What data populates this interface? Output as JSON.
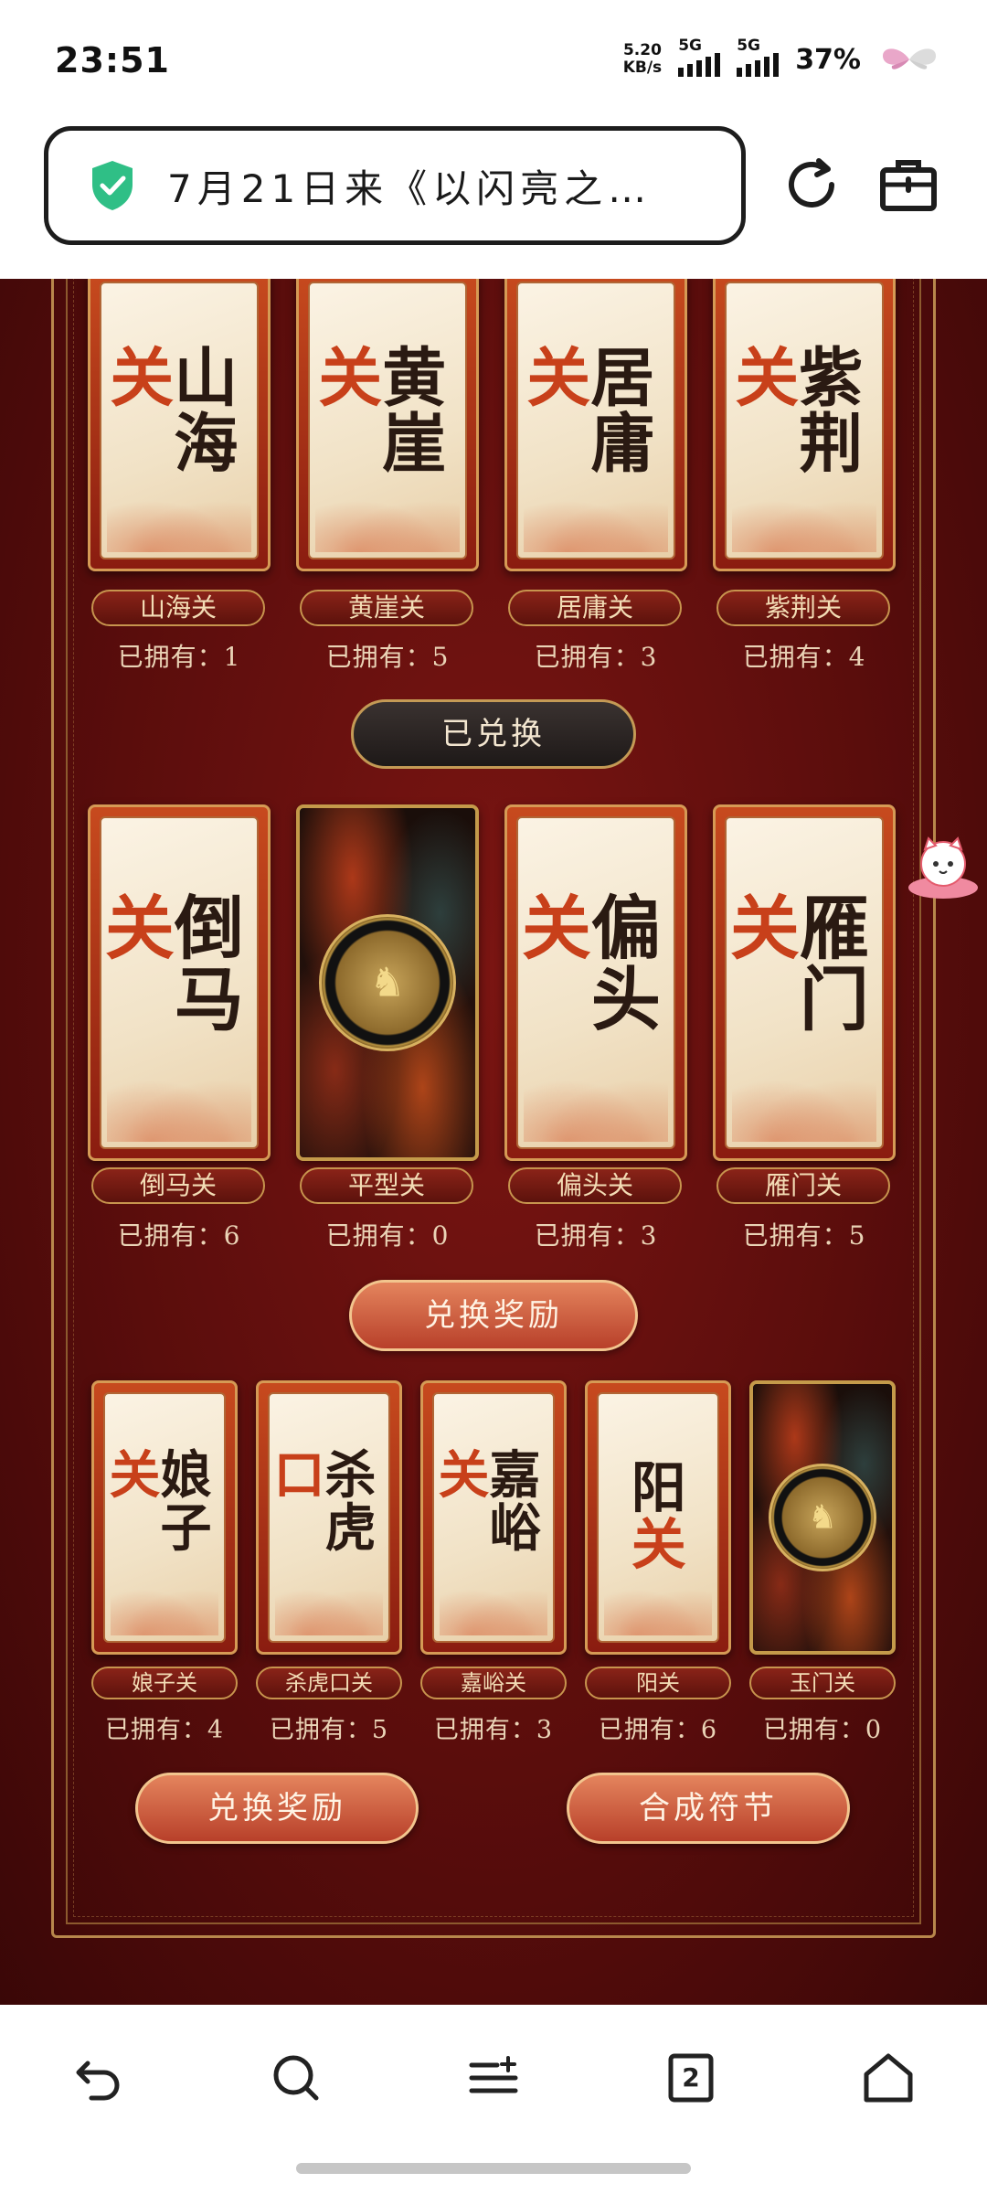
{
  "status_bar": {
    "time": "23:51",
    "net_speed_value": "5.20",
    "net_speed_unit": "KB/s",
    "sim1": "5G",
    "sim2": "5G",
    "battery": "37%"
  },
  "url_bar": {
    "title": "7月21日来《以闪亮之…"
  },
  "colors": {
    "bg_red": "#5a0d0c",
    "gold": "#c7944e",
    "paper": "#f5ead6"
  },
  "buttons": {
    "redeemed": "已兑换",
    "redeem_reward_1": "兑换奖励",
    "redeem_reward_2": "兑换奖励",
    "synthesize": "合成符节"
  },
  "owned_prefix": "已拥有：",
  "row1": [
    {
      "big": "山海关",
      "name": "山海关",
      "owned": "已拥有：1"
    },
    {
      "big": "黄崖关",
      "name": "黄崖关",
      "owned": "已拥有：5"
    },
    {
      "big": "居庸关",
      "name": "居庸关",
      "owned": "已拥有：3"
    },
    {
      "big": "紫荆关",
      "name": "紫荆关",
      "owned": "已拥有：4"
    }
  ],
  "row2": [
    {
      "big": "倒马关",
      "name": "倒马关",
      "owned": "已拥有：6"
    },
    {
      "big": "",
      "name": "平型关",
      "owned": "已拥有：0",
      "locked": true
    },
    {
      "big": "偏头关",
      "name": "偏头关",
      "owned": "已拥有：3"
    },
    {
      "big": "雁门关",
      "name": "雁门关",
      "owned": "已拥有：5"
    }
  ],
  "row3": [
    {
      "big": "娘子关",
      "name": "娘子关",
      "owned": "已拥有：4"
    },
    {
      "big": "杀虎口",
      "name": "杀虎口关",
      "owned": "已拥有：5"
    },
    {
      "big": "嘉峪关",
      "name": "嘉峪关",
      "owned": "已拥有：3"
    },
    {
      "big": "阳关",
      "name": "阳关",
      "owned": "已拥有：6"
    },
    {
      "big": "",
      "name": "玉门关",
      "owned": "已拥有：0",
      "locked": true
    }
  ],
  "bottom_nav": {
    "tab_count": "2"
  }
}
